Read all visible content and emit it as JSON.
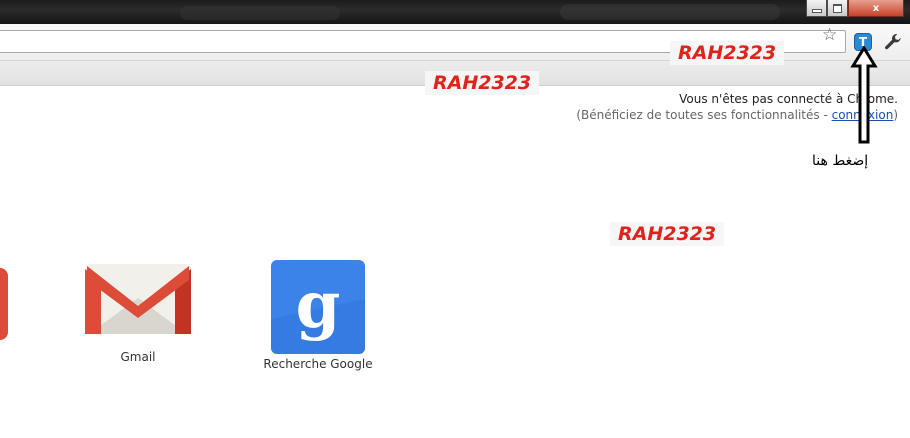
{
  "window": {
    "minimize_icon": "minimize-icon",
    "maximize_icon": "maximize-icon",
    "close_icon": "close-icon",
    "close_glyph": "x"
  },
  "toolbar": {
    "omnibox_value": "",
    "star_icon": "star-icon",
    "extension_icon_letter": "T",
    "wrench_icon": "wrench-icon"
  },
  "watermarks": [
    "RAH2323",
    "RAH2323",
    "RAH2323"
  ],
  "signin": {
    "line1": "Vous n'êtes pas connecté à Chrome.",
    "line2_before": "(Bénéficiez de toutes ses fonctionnalités - ",
    "link": "connexion",
    "line2_after": ")"
  },
  "annotation": {
    "label": "إضغط هنا",
    "arrow_icon": "arrow-up-icon"
  },
  "apps": [
    {
      "name": "Gmail",
      "icon": "gmail-icon"
    },
    {
      "name": "Recherche Google",
      "icon": "google-search-icon"
    }
  ],
  "colors": {
    "watermark": "#e2231a",
    "gmail_red": "#dd4b39",
    "google_blue": "#3b83e8",
    "link": "#1a4fb5"
  }
}
